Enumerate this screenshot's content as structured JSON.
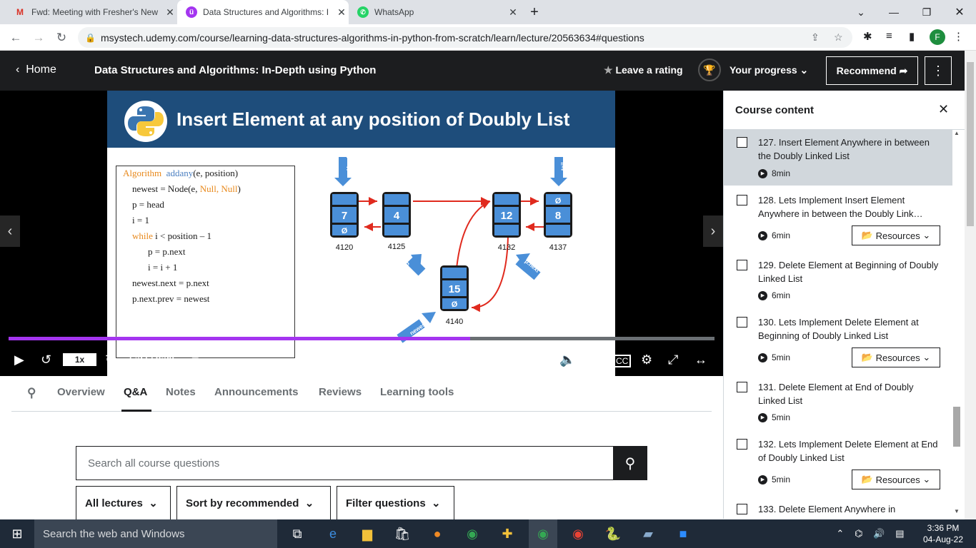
{
  "browser": {
    "tabs": [
      {
        "label": "Fwd: Meeting with Fresher's New",
        "icon": "gmail-icon"
      },
      {
        "label": "Data Structures and Algorithms: I",
        "icon": "udemy-icon"
      },
      {
        "label": "WhatsApp",
        "icon": "whatsapp-icon"
      }
    ],
    "new_tab": "+",
    "url": "msystech.udemy.com/course/learning-data-structures-algorithms-in-python-from-scratch/learn/lecture/20563634#questions",
    "profile_initial": "F"
  },
  "header": {
    "home": "Home",
    "course_title": "Data Structures and Algorithms: In-Depth using Python",
    "rating": "Leave a rating",
    "progress": "Your progress",
    "recommend": "Recommend"
  },
  "slide": {
    "title": "Insert Element at any position of Doubly List",
    "algorithm": {
      "l1_kw": "Algorithm",
      "l1_fn": "addany",
      "l1_args": "(e, position)",
      "l2_a": "newest = Node(e, ",
      "l2_b": "Null, Null",
      "l2_c": ")",
      "l3": "p = head",
      "l4": "i = 1",
      "l5_kw": "while",
      "l5_rest": " i < position – 1",
      "l6": "p = p.next",
      "l7": "i = i + 1",
      "l8": "newest.next = p.next",
      "l9": "p.next.prev = newest"
    },
    "nodes": [
      {
        "value": "7",
        "addr": "4120",
        "prev": "",
        "next": "Ø"
      },
      {
        "value": "4",
        "addr": "4125"
      },
      {
        "value": "12",
        "addr": "4132"
      },
      {
        "value": "8",
        "addr": "4137",
        "prev": "Ø"
      },
      {
        "value": "15",
        "addr": "4140",
        "next": "Ø"
      }
    ],
    "pointers": {
      "head": "Head",
      "tail": "tail",
      "p": "p",
      "pnext": "p.next",
      "newest": "newest"
    }
  },
  "player": {
    "speed": "1x",
    "time": "5:27 / 8:20",
    "progress_fraction": 0.654
  },
  "content_tabs": [
    "Overview",
    "Q&A",
    "Notes",
    "Announcements",
    "Reviews",
    "Learning tools"
  ],
  "qa": {
    "search_placeholder": "Search all course questions",
    "filters": [
      "All lectures",
      "Sort by recommended",
      "Filter questions"
    ]
  },
  "sidebar": {
    "title": "Course content",
    "items": [
      {
        "title": "127. Insert Element Anywhere in between the Doubly Linked List",
        "duration": "8min",
        "resources": "",
        "active": true
      },
      {
        "title": "128. Lets Implement Insert Element Anywhere in between the Doubly Link…",
        "duration": "6min",
        "resources": "Resources"
      },
      {
        "title": "129. Delete Element at Beginning of Doubly Linked List",
        "duration": "6min",
        "resources": ""
      },
      {
        "title": "130. Lets Implement Delete Element at Beginning of Doubly Linked List",
        "duration": "5min",
        "resources": "Resources"
      },
      {
        "title": "131. Delete Element at End of Doubly Linked List",
        "duration": "5min",
        "resources": ""
      },
      {
        "title": "132. Lets Implement Delete Element at End of Doubly Linked List",
        "duration": "5min",
        "resources": "Resources"
      },
      {
        "title": "133. Delete Element Anywhere in",
        "duration": "",
        "resources": ""
      }
    ]
  },
  "taskbar": {
    "search": "Search the web and Windows",
    "time": "3:36 PM",
    "date": "04-Aug-22"
  },
  "colors": {
    "accent": "#a435f0",
    "dark": "#1c1d1f",
    "slide_band": "#1e4d7b",
    "node": "#4a8fd8"
  }
}
